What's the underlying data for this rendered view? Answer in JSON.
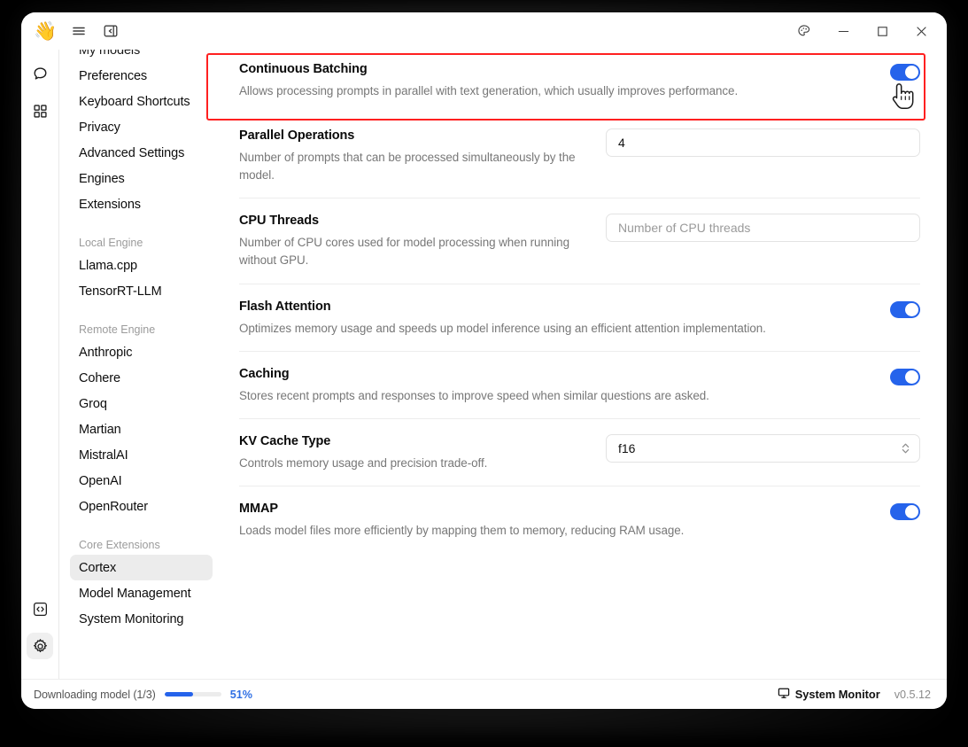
{
  "titlebar": {
    "wave_icon": "wave-hand-icon",
    "menu_icon": "hamburger-menu-icon",
    "panel_icon": "collapse-panel-icon",
    "theme_icon": "palette-icon",
    "minimize_icon": "minimize-icon",
    "maximize_icon": "maximize-icon",
    "close_icon": "close-icon"
  },
  "rail": {
    "items": [
      {
        "name": "chat-icon",
        "active": false
      },
      {
        "name": "apps-grid-icon",
        "active": false
      }
    ],
    "bottom": [
      {
        "name": "code-icon",
        "active": false
      },
      {
        "name": "gear-icon",
        "active": true
      }
    ]
  },
  "nav": {
    "items": [
      {
        "label": "My models",
        "active": false,
        "group": false
      },
      {
        "label": "Preferences",
        "active": false,
        "group": false
      },
      {
        "label": "Keyboard Shortcuts",
        "active": false,
        "group": false
      },
      {
        "label": "Privacy",
        "active": false,
        "group": false
      },
      {
        "label": "Advanced Settings",
        "active": false,
        "group": false
      },
      {
        "label": "Engines",
        "active": false,
        "group": false
      },
      {
        "label": "Extensions",
        "active": false,
        "group": false
      },
      {
        "label": "Local Engine",
        "active": false,
        "group": true
      },
      {
        "label": "Llama.cpp",
        "active": false,
        "group": false
      },
      {
        "label": "TensorRT-LLM",
        "active": false,
        "group": false
      },
      {
        "label": "Remote Engine",
        "active": false,
        "group": true
      },
      {
        "label": "Anthropic",
        "active": false,
        "group": false
      },
      {
        "label": "Cohere",
        "active": false,
        "group": false
      },
      {
        "label": "Groq",
        "active": false,
        "group": false
      },
      {
        "label": "Martian",
        "active": false,
        "group": false
      },
      {
        "label": "MistralAI",
        "active": false,
        "group": false
      },
      {
        "label": "OpenAI",
        "active": false,
        "group": false
      },
      {
        "label": "OpenRouter",
        "active": false,
        "group": false
      },
      {
        "label": "Core Extensions",
        "active": false,
        "group": true
      },
      {
        "label": "Cortex",
        "active": true,
        "group": false
      },
      {
        "label": "Model Management",
        "active": false,
        "group": false
      },
      {
        "label": "System Monitoring",
        "active": false,
        "group": false
      }
    ]
  },
  "settings": {
    "rows": [
      {
        "title": "Continuous Batching",
        "desc": "Allows processing prompts in parallel with text generation, which usually improves performance.",
        "control": "toggle",
        "value": "on"
      },
      {
        "title": "Parallel Operations",
        "desc": "Number of prompts that can be processed simultaneously by the model.",
        "control": "input",
        "value": "4",
        "placeholder": ""
      },
      {
        "title": "CPU Threads",
        "desc": "Number of CPU cores used for model processing when running without GPU.",
        "control": "input",
        "value": "",
        "placeholder": "Number of CPU threads"
      },
      {
        "title": "Flash Attention",
        "desc": "Optimizes memory usage and speeds up model inference using an efficient attention implementation.",
        "control": "toggle",
        "value": "on"
      },
      {
        "title": "Caching",
        "desc": "Stores recent prompts and responses to improve speed when similar questions are asked.",
        "control": "toggle",
        "value": "on"
      },
      {
        "title": "KV Cache Type",
        "desc": "Controls memory usage and precision trade-off.",
        "control": "select",
        "value": "f16"
      },
      {
        "title": "MMAP",
        "desc": "Loads model files more efficiently by mapping them to memory, reducing RAM usage.",
        "control": "toggle",
        "value": "on"
      }
    ]
  },
  "statusbar": {
    "download_label": "Downloading model (1/3)",
    "progress_percent": "51%",
    "progress_value": 51,
    "system_monitor_label": "System Monitor",
    "monitor_icon": "monitor-icon",
    "version": "v0.5.12"
  },
  "colors": {
    "accent": "#2563eb",
    "highlight": "#ff2020",
    "nav_active_bg": "#ececec"
  }
}
